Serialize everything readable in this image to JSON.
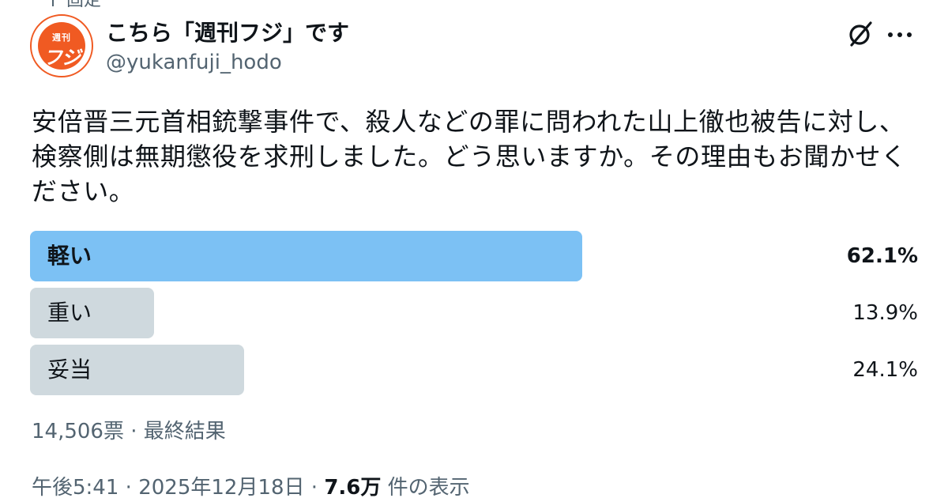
{
  "pinned": {
    "label": "固定"
  },
  "author": {
    "avatar_top_text": "週刊",
    "avatar_main_text": "フジ",
    "display_name": "こちら「週刊フジ」です",
    "handle": "@yukanfuji_hodo",
    "brand_color": "#f05a22"
  },
  "header_actions": {
    "grok_icon": "grok-icon",
    "more_icon": "more-dots-icon"
  },
  "tweet": {
    "text": "安倍晋三元首相銃撃事件で、殺人などの罪に問われた山上徹也被告に対し、検察側は無期懲役を求刑しました。どう思いますか。その理由もお聞かせください。"
  },
  "poll": {
    "options": [
      {
        "label": "軽い",
        "percent_text": "62.1%",
        "value": 62.1,
        "winner": true
      },
      {
        "label": "重い",
        "percent_text": "13.9%",
        "value": 13.9,
        "winner": false
      },
      {
        "label": "妥当",
        "percent_text": "24.1%",
        "value": 24.1,
        "winner": false
      }
    ],
    "summary": "14,506票 · 最終結果",
    "colors": {
      "winner_bar": "#7cc1f4",
      "other_bar": "#cfd9de"
    }
  },
  "meta": {
    "time": "午後5:41",
    "separator": " · ",
    "date": "2025年12月18日",
    "views_count": "7.6万",
    "views_label": " 件の表示"
  }
}
